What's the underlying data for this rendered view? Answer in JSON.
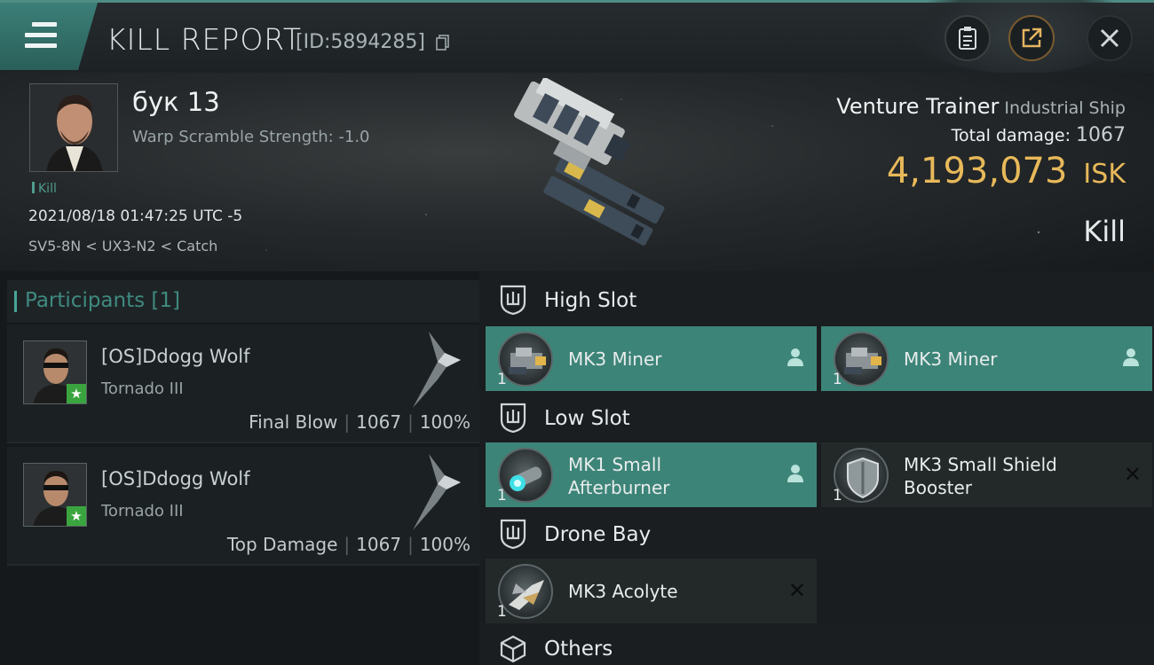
{
  "header": {
    "title": "KILL REPORT",
    "report_id": "[ID:5894285]",
    "icons": [
      "menu-icon",
      "clipboard-icon",
      "share-icon",
      "close-icon"
    ]
  },
  "victim": {
    "name": "бук 13",
    "warp_scramble": "Warp Scramble Strength: -1.0",
    "kill_tag": "Kill",
    "datetime": "2021/08/18 01:47:25 UTC -5",
    "location": "SV5-8N < UX3-N2 < Catch"
  },
  "ship": {
    "name": "Venture Trainer",
    "class": "Industrial Ship",
    "total_damage_label": "Total damage:",
    "total_damage": "1067",
    "isk_value": "4,193,073",
    "currency": "ISK",
    "result": "Kill"
  },
  "participants": {
    "header": "Participants [1]",
    "rows": [
      {
        "name": "[OS]Ddogg Wolf",
        "ship": "Tornado III",
        "role": "Final Blow",
        "damage": "1067",
        "percent": "100%"
      },
      {
        "name": "[OS]Ddogg Wolf",
        "ship": "Tornado III",
        "role": "Top Damage",
        "damage": "1067",
        "percent": "100%"
      }
    ]
  },
  "fitting": {
    "high_slot": {
      "label": "High Slot",
      "items": [
        {
          "line1": "MK3 Miner",
          "line2": "",
          "qty": "1",
          "status": "fitted"
        },
        {
          "line1": "MK3 Miner",
          "line2": "",
          "qty": "1",
          "status": "fitted"
        }
      ]
    },
    "low_slot": {
      "label": "Low Slot",
      "items": [
        {
          "line1": "MK1 Small",
          "line2": "Afterburner",
          "qty": "1",
          "status": "fitted"
        },
        {
          "line1": "MK3 Small Shield",
          "line2": "Booster",
          "qty": "1",
          "status": "destroyed"
        }
      ]
    },
    "drone_bay": {
      "label": "Drone Bay",
      "items": [
        {
          "line1": "MK3  Acolyte",
          "line2": "",
          "qty": "1",
          "status": "destroyed"
        }
      ]
    },
    "others": {
      "label": "Others"
    }
  },
  "colors": {
    "accent": "#3d8478",
    "isk": "#e8b95a",
    "destroyed_x": "#0c0d0e"
  }
}
